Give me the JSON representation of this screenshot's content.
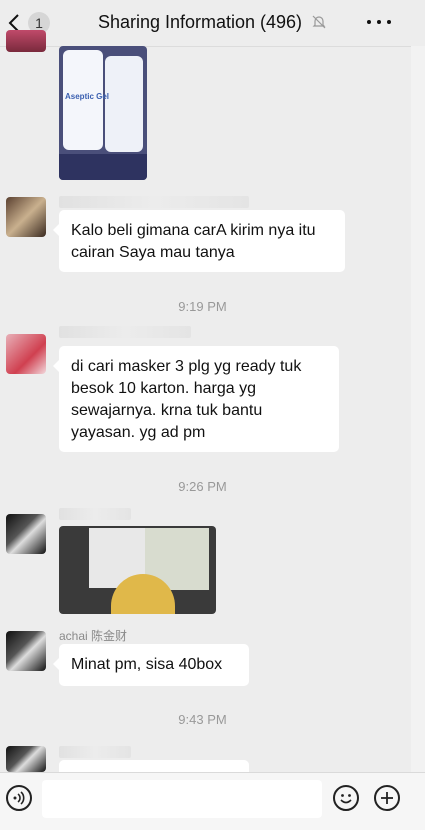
{
  "header": {
    "back_count": "1",
    "title": "Sharing Information (496)"
  },
  "messages": [
    {
      "text": "Kalo beli gimana carA kirim nya itu cairan Saya mau tanya"
    },
    {
      "text": "di cari masker 3 plg yg ready tuk besok 10 karton.  harga yg sewajarnya. krna tuk bantu yayasan.   yg ad pm"
    },
    {
      "sender": "achai 陈金财",
      "text": "Minat pm, sisa 40box"
    }
  ],
  "timestamps": [
    "9:19 PM",
    "9:26 PM",
    "9:43 PM"
  ],
  "images": {
    "gel_label": "Aseptic Gel"
  },
  "colors": {
    "background": "#ededed",
    "bubble": "#ffffff",
    "time_text": "#999999"
  }
}
